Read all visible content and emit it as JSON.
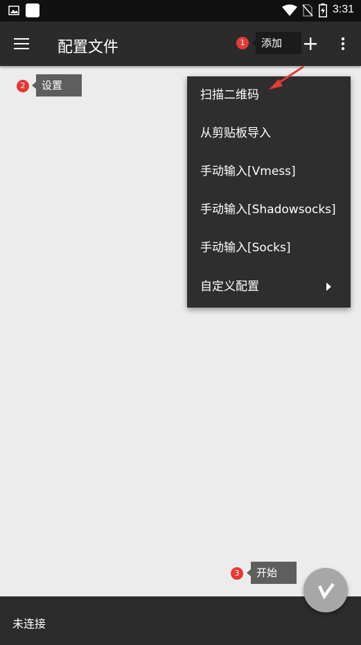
{
  "statusbar": {
    "time": "3:31",
    "icons": [
      "image-icon",
      "app-icon",
      "wifi-icon",
      "no-sim-icon",
      "battery-charging-icon"
    ]
  },
  "toolbar": {
    "title": "配置文件",
    "menu_icon": "hamburger-icon",
    "add_icon": "plus-icon",
    "more_icon": "more-vert-icon"
  },
  "annotations": [
    {
      "number": "1",
      "text": "添加"
    },
    {
      "number": "2",
      "text": "设置"
    },
    {
      "number": "3",
      "text": "开始"
    }
  ],
  "popup_menu": {
    "items": [
      {
        "label": "扫描二维码"
      },
      {
        "label": "从剪贴板导入"
      },
      {
        "label": "手动输入[Vmess]"
      },
      {
        "label": "手动输入[Shadowsocks]"
      },
      {
        "label": "手动输入[Socks]"
      },
      {
        "label": "自定义配置",
        "has_submenu": true
      }
    ]
  },
  "bottom": {
    "status": "未连接"
  },
  "fab": {
    "icon": "v-logo-icon"
  },
  "colors": {
    "toolbar": "#2b2b2b",
    "background": "#ececec",
    "menu": "#2e2e2e",
    "badge": "#e53935",
    "arrow": "#e53935",
    "fab": "#a7a7a7"
  }
}
